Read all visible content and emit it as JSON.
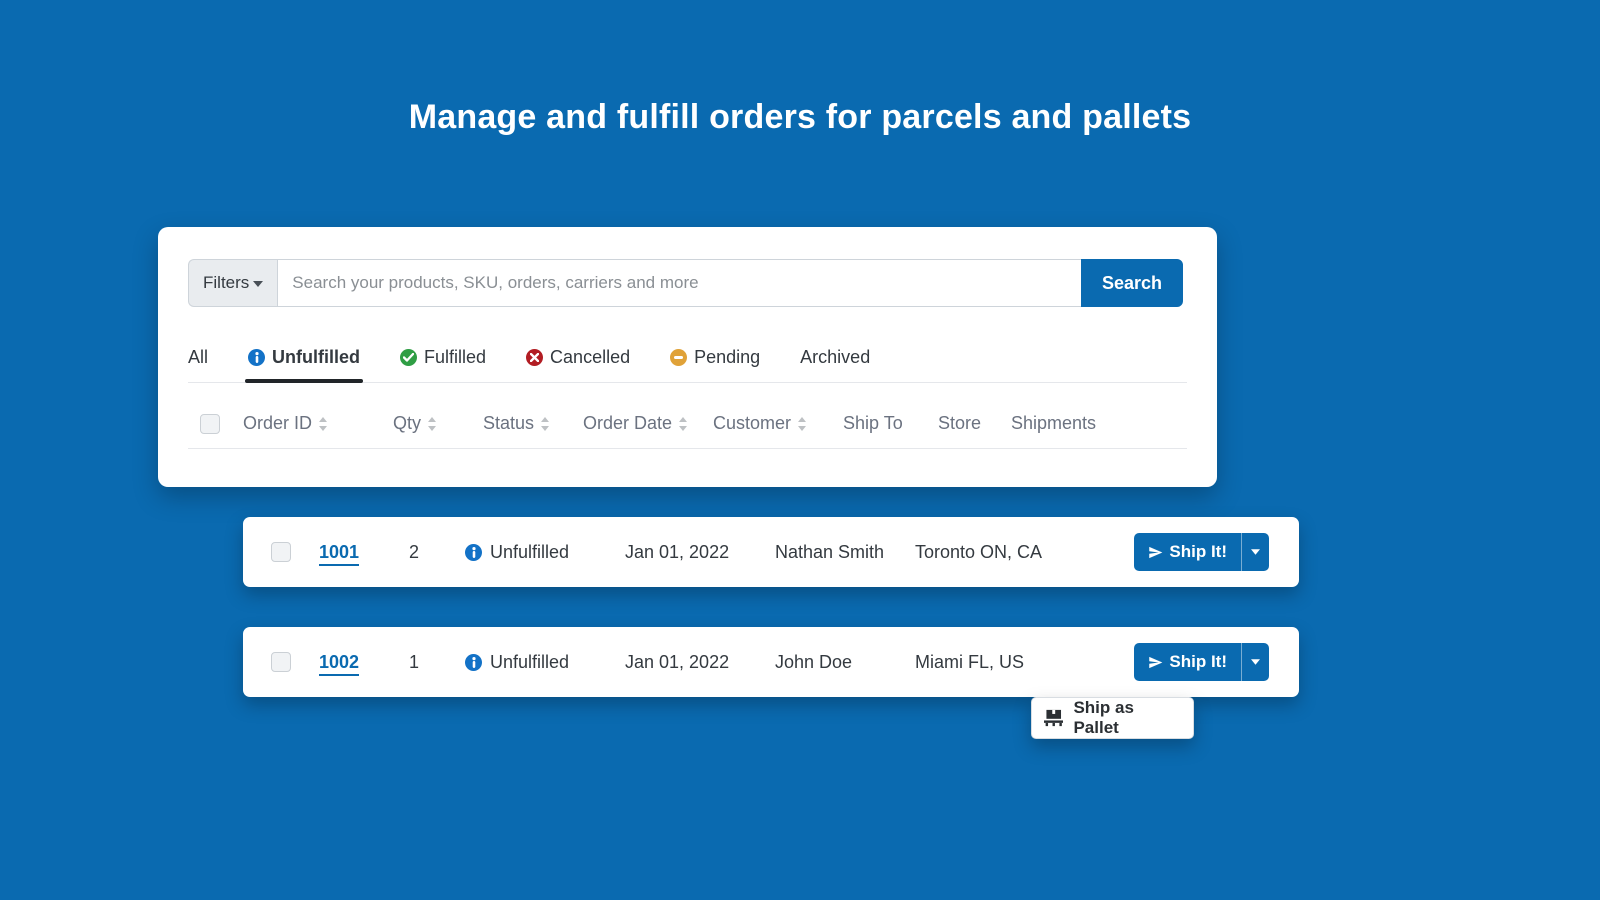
{
  "title": "Manage and fulfill orders for parcels and pallets",
  "filters": {
    "label": "Filters",
    "search_placeholder": "Search your products, SKU, orders, carriers and more",
    "search_button": "Search"
  },
  "tabs": [
    {
      "label": "All",
      "icon": null,
      "active": false
    },
    {
      "label": "Unfulfilled",
      "icon": "blue",
      "active": true
    },
    {
      "label": "Fulfilled",
      "icon": "green",
      "active": false
    },
    {
      "label": "Cancelled",
      "icon": "red",
      "active": false
    },
    {
      "label": "Pending",
      "icon": "amber",
      "active": false
    },
    {
      "label": "Archived",
      "icon": null,
      "active": false
    }
  ],
  "columns": {
    "order_id": "Order ID",
    "qty": "Qty",
    "status": "Status",
    "order_date": "Order Date",
    "customer": "Customer",
    "ship_to": "Ship To",
    "store": "Store",
    "shipments": "Shipments"
  },
  "rows": [
    {
      "order_id": "1001",
      "qty": "2",
      "status": "Unfulfilled",
      "order_date": "Jan 01, 2022",
      "customer": "Nathan Smith",
      "ship_to": "Toronto ON, CA"
    },
    {
      "order_id": "1002",
      "qty": "1",
      "status": "Unfulfilled",
      "order_date": "Jan 01, 2022",
      "customer": "John Doe",
      "ship_to": "Miami FL, US"
    }
  ],
  "ship_button": "Ship It!",
  "dropdown_option": "Ship as Pallet"
}
